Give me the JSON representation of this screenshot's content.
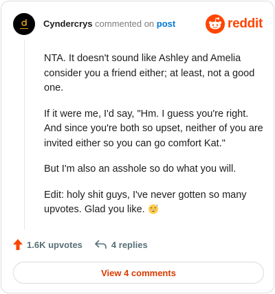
{
  "header": {
    "username": "Cyndercrys",
    "action": "commented on",
    "post_link": "post",
    "brand": "reddit"
  },
  "comment": {
    "paragraphs": [
      "NTA. It doesn't sound like Ashley and Amelia consider you a friend either; at least, not a good one.",
      "If it were me, I'd say, \"Hm. I guess you're right. And since you're both so upset, neither of you are invited either so you can go comfort Kat.\"",
      "But I'm also an asshole so do what you will.",
      "Edit: holy shit guys, I've never gotten so many upvotes. Glad you like."
    ],
    "emoji": "grinning-sweat-emoji"
  },
  "stats": {
    "upvotes": "1.6K upvotes",
    "replies": "4 replies"
  },
  "footer": {
    "view_comments": "View 4 comments"
  },
  "colors": {
    "brand": "#ff4500",
    "link": "#0079d3",
    "upvote": "#ff4500",
    "view_button_text": "#d93a00"
  }
}
